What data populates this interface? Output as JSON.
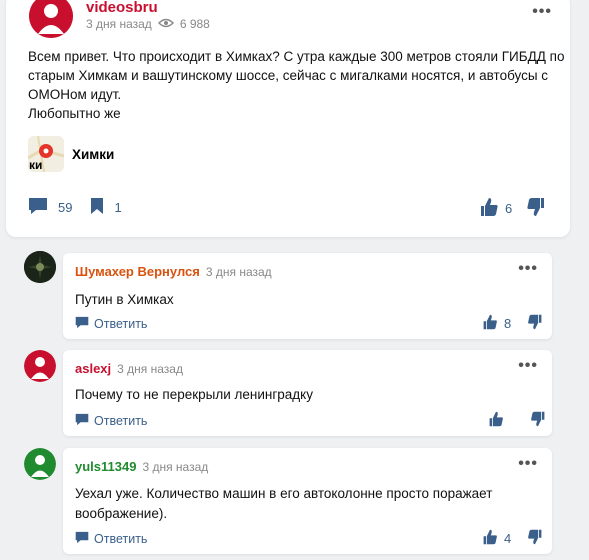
{
  "post": {
    "author": "videosbru",
    "time": "3 дня назад",
    "views": "6 988",
    "text_lines": [
      "Всем привет. Что происходит в Химках? С утра каждые 300 метров стояли ГИБДД по старым Химкам и вашутинскому шоссе, сейчас с мигалками носятся, и автобусы с ОМОНом идут.",
      "Любопытно же"
    ],
    "location": "Химки",
    "map_icon_text": "ки",
    "comments_count": "59",
    "bookmarks_count": "1",
    "likes": "6",
    "colors": {
      "author": "#c8102e",
      "action": "#3a5f8a"
    }
  },
  "comments": [
    {
      "author": "Шумахер Вернулся",
      "author_color": "#d9530f",
      "time": "3 дня назад",
      "text": "Путин в Химках",
      "reply_label": "Ответить",
      "likes": "8",
      "avatar": "dark"
    },
    {
      "author": "aslexj",
      "author_color": "#c8102e",
      "time": "3 дня назад",
      "text": "Почему то не перекрыли ленинградку",
      "reply_label": "Ответить",
      "likes": "",
      "avatar": "red"
    },
    {
      "author": "yuls11349",
      "author_color": "#1f8a2e",
      "time": "3 дня назад",
      "text": "Уехал уже. Количество машин в его автоколонне просто поражает воображение).",
      "reply_label": "Ответить",
      "likes": "4",
      "avatar": "green"
    }
  ]
}
